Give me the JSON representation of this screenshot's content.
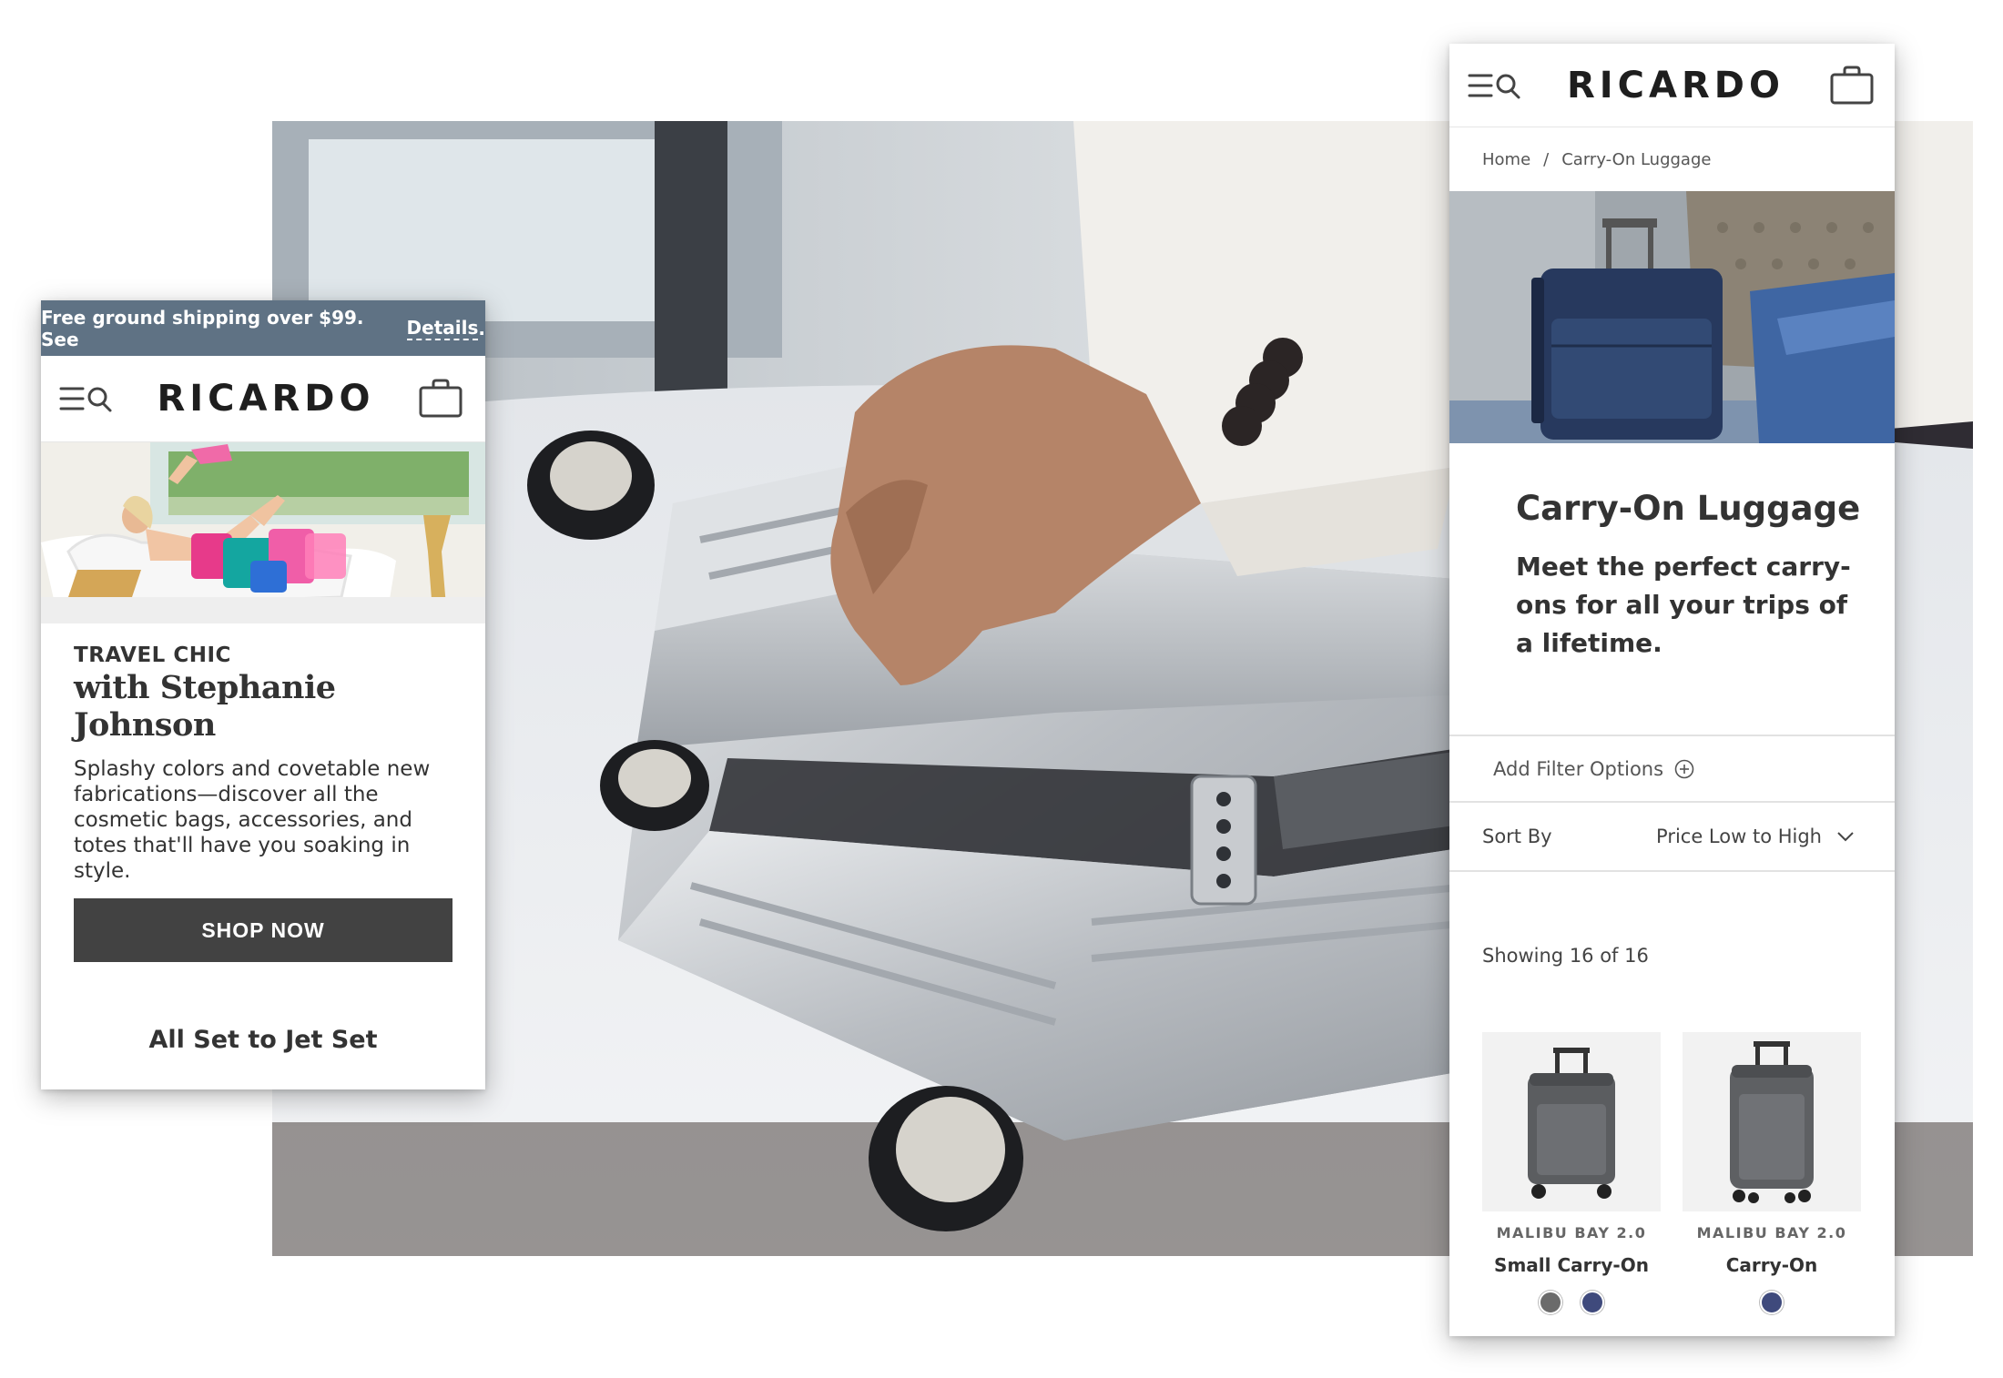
{
  "left_phone": {
    "promo": {
      "text": "Free ground shipping over $99. See ",
      "link": "Details",
      "suffix": "."
    },
    "logo": "RICARDO",
    "feature": {
      "eyebrow": "TRAVEL CHIC",
      "headline": "with Stephanie Johnson",
      "body": "Splashy colors and covetable new fabrications—discover all the cosmetic bags, accessories, and totes that'll have you soaking in style.",
      "cta": "SHOP NOW"
    },
    "section_title": "All Set to Jet Set"
  },
  "right_phone": {
    "logo": "RICARDO",
    "breadcrumb": {
      "home": "Home",
      "separator": "/",
      "current": "Carry-On Luggage"
    },
    "category": {
      "title": "Carry-On Luggage",
      "description": "Meet the perfect carry-ons for all your trips of a lifetime."
    },
    "filter_label": "Add Filter Options",
    "sort": {
      "label": "Sort By",
      "value": "Price Low to High"
    },
    "showing": "Showing 16 of 16",
    "products": [
      {
        "brand": "MALIBU BAY 2.0",
        "name": "Small Carry-On",
        "swatches": [
          "#6b6b6b",
          "#3f4a7c"
        ]
      },
      {
        "brand": "MALIBU BAY 2.0",
        "name": "Carry-On",
        "swatches": [
          "#3f4a7c"
        ]
      }
    ]
  },
  "icons": [
    "menu-search-icon",
    "shopping-bag-icon",
    "plus-circle-icon",
    "chevron-down-icon"
  ],
  "colors": {
    "promo_bar": "#5f7284",
    "cta": "#424242",
    "text": "#333333"
  }
}
